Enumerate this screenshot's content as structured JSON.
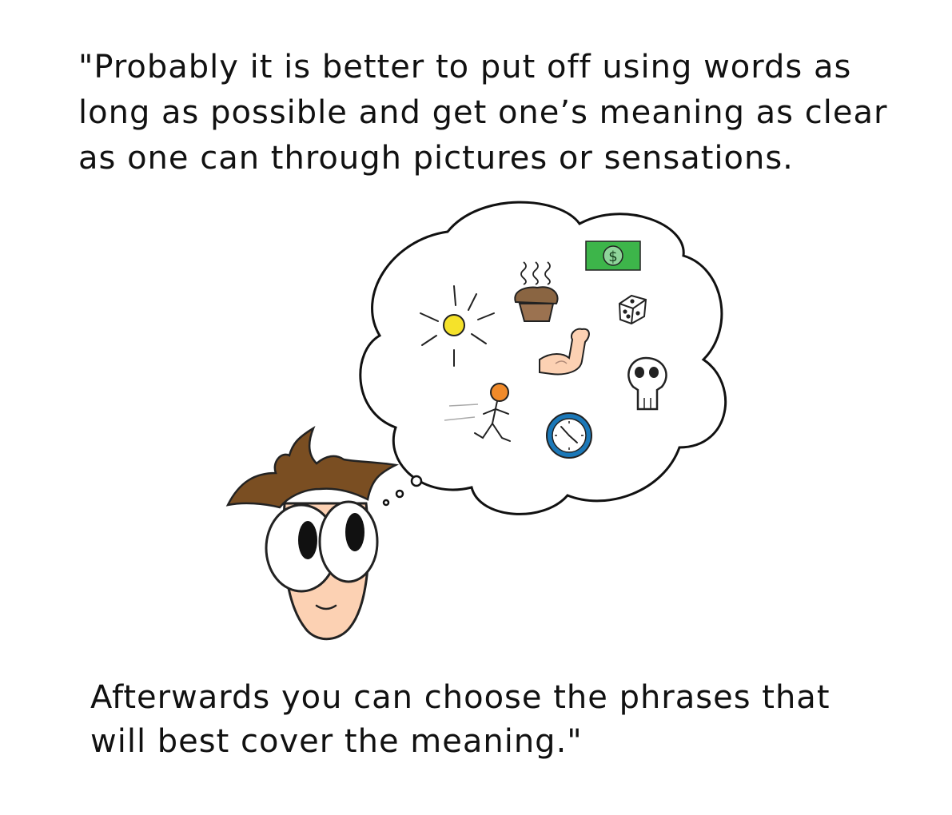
{
  "quote": {
    "top_lines": [
      "\"Probably it is better to put off using words as",
      "long as possible and get one’s meaning as clear",
      "as one can through pictures or sensations."
    ],
    "bottom_lines": [
      "Afterwards you can choose the phrases that",
      "will best cover the meaning.\""
    ]
  },
  "illustration": {
    "subjects": [
      "sun-icon",
      "steaming-muffin-icon",
      "money-icon",
      "dice-icon",
      "flexed-arm-icon",
      "skull-icon",
      "running-figure-icon",
      "clock-icon",
      "person-head"
    ],
    "money_symbol": "$",
    "colors": {
      "money_green": "#3db54a",
      "sun_yellow": "#f5e22a",
      "muffin_brown": "#8a6542",
      "runner_orange": "#f08a2a",
      "clock_blue": "#1b78b8",
      "hair_brown": "#7a4e22",
      "skin": "#fcd1b3"
    }
  }
}
